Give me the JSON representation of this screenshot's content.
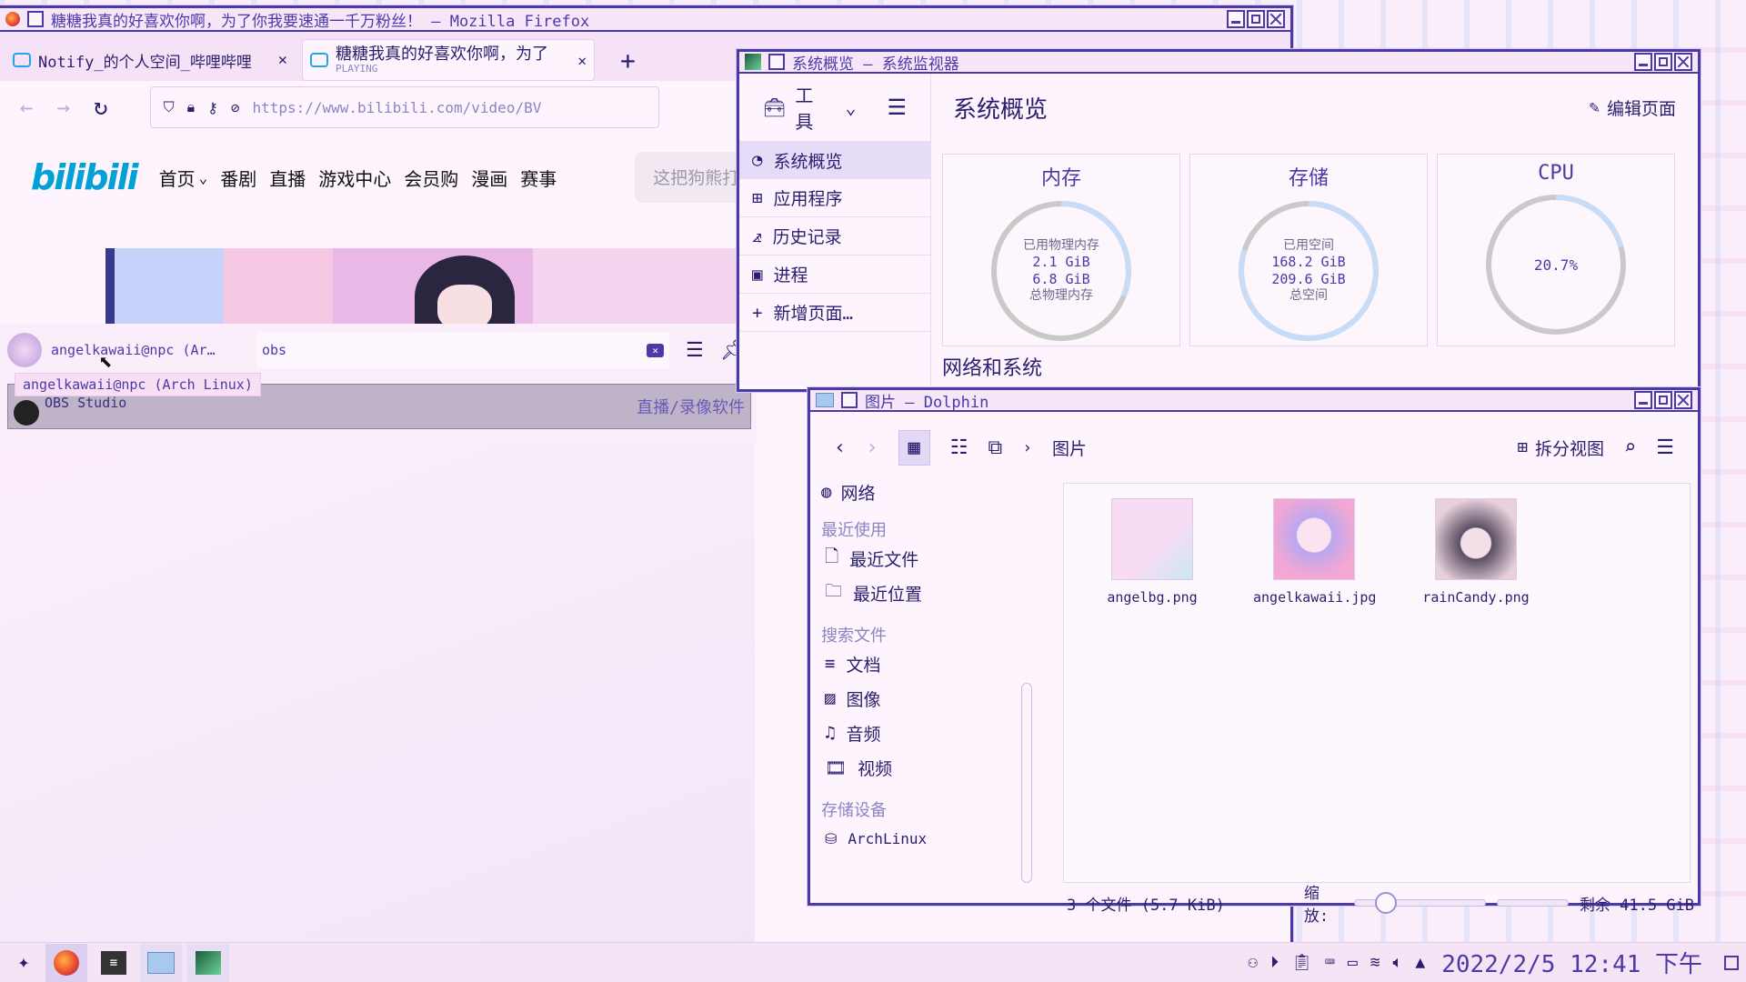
{
  "firefox": {
    "title": "糖糖我真的好喜欢你啊，为了你我要速通一千万粉丝！ — Mozilla Firefox",
    "tabs": [
      {
        "label": "Notify_的个人空间_哔哩哔哩"
      },
      {
        "label": "糖糖我真的好喜欢你啊，为了",
        "sub": "PLAYING"
      }
    ],
    "url": "https://www.bilibili.com/video/BV",
    "site": {
      "logo": "bilibili",
      "nav": [
        "首页",
        "番剧",
        "直播",
        "游戏中心",
        "会员购",
        "漫画",
        "赛事"
      ],
      "search_placeholder": "这把狗熊打"
    }
  },
  "krunner": {
    "user": "angelkawaii@npc (Ar…",
    "query": "obs",
    "tooltip": "angelkawaii@npc (Arch Linux)",
    "result": {
      "name": "OBS Studio",
      "category": "直播/录像软件"
    }
  },
  "sysmon": {
    "title": "系统概览 — 系统监视器",
    "tools_label": "工具",
    "page_title": "系统概览",
    "edit_label": "编辑页面",
    "nav": [
      "系统概览",
      "应用程序",
      "历史记录",
      "进程",
      "新增页面…"
    ],
    "cards": [
      {
        "title": "内存",
        "lines": [
          "已用物理内存",
          "2.1 GiB",
          "6.8 GiB",
          "总物理内存"
        ],
        "fraction": 0.31
      },
      {
        "title": "存储",
        "lines": [
          "已用空间",
          "168.2 GiB",
          "209.6 GiB",
          "总空间"
        ],
        "fraction": 0.8
      },
      {
        "title": "CPU",
        "lines": [
          "20.7%"
        ],
        "fraction": 0.207
      }
    ],
    "section": "网络和系统"
  },
  "dolphin": {
    "title": "图片 — Dolphin",
    "crumb": "图片",
    "split_label": "拆分视图",
    "sidebar": {
      "network": "网络",
      "recent_header": "最近使用",
      "recent": [
        "最近文件",
        "最近位置"
      ],
      "search_header": "搜索文件",
      "search": [
        "文档",
        "图像",
        "音频",
        "视频"
      ],
      "devices_header": "存储设备",
      "devices": [
        "ArchLinux"
      ]
    },
    "files": [
      {
        "name": "angelbg.png"
      },
      {
        "name": "angelkawaii.jpg"
      },
      {
        "name": "rainCandy.png"
      }
    ],
    "status": {
      "count": "3 个文件 (5.7 KiB)",
      "zoom_label": "缩放:",
      "free": "剩余 41.5 GiB"
    }
  },
  "taskbar": {
    "clock": "2022/2/5 12:41 下午"
  },
  "colors": {
    "accent": "#4a3aa8",
    "ring_fill": "#c8dcf8",
    "ring_track": "#c9c9c9",
    "bilibili_blue": "#00a1d6"
  }
}
